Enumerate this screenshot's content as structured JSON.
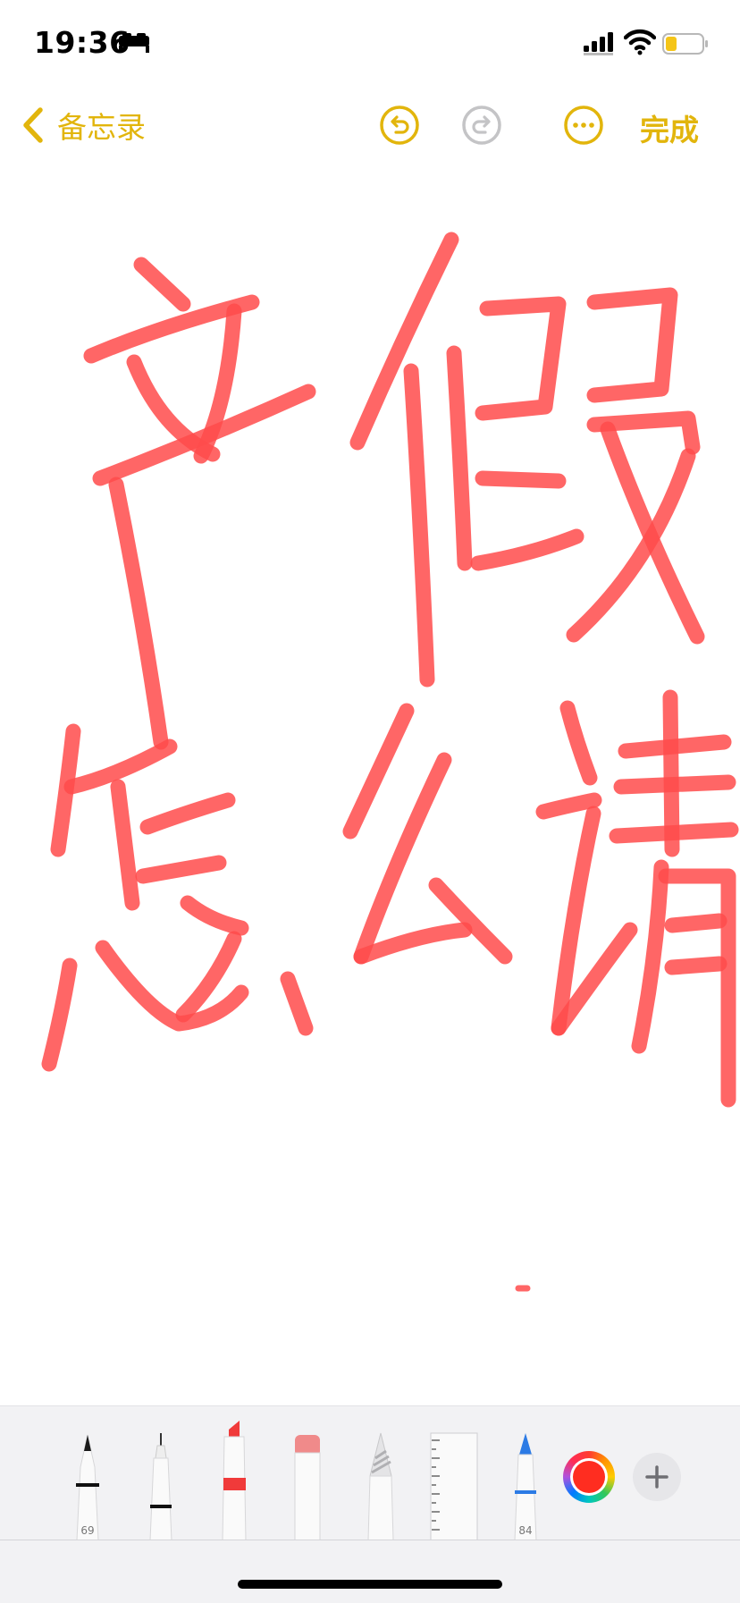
{
  "status_bar": {
    "time": "19:36",
    "icons": [
      "bed-icon",
      "cellular-signal-icon",
      "wifi-icon",
      "battery-icon"
    ]
  },
  "nav": {
    "back_label": "备忘录",
    "done_label": "完成",
    "icons": [
      "chevron-left-icon",
      "undo-icon",
      "redo-icon",
      "more-icon"
    ]
  },
  "palette": {
    "pen_size": "69",
    "crayon_size": "84",
    "tools": [
      "pen",
      "fineliner",
      "marker",
      "eraser",
      "pencil",
      "ruler",
      "crayon"
    ]
  },
  "colors": {
    "accent": "#E2B50C",
    "ink": "#FF4B4B",
    "redo_disabled": "#C4C4C6"
  }
}
